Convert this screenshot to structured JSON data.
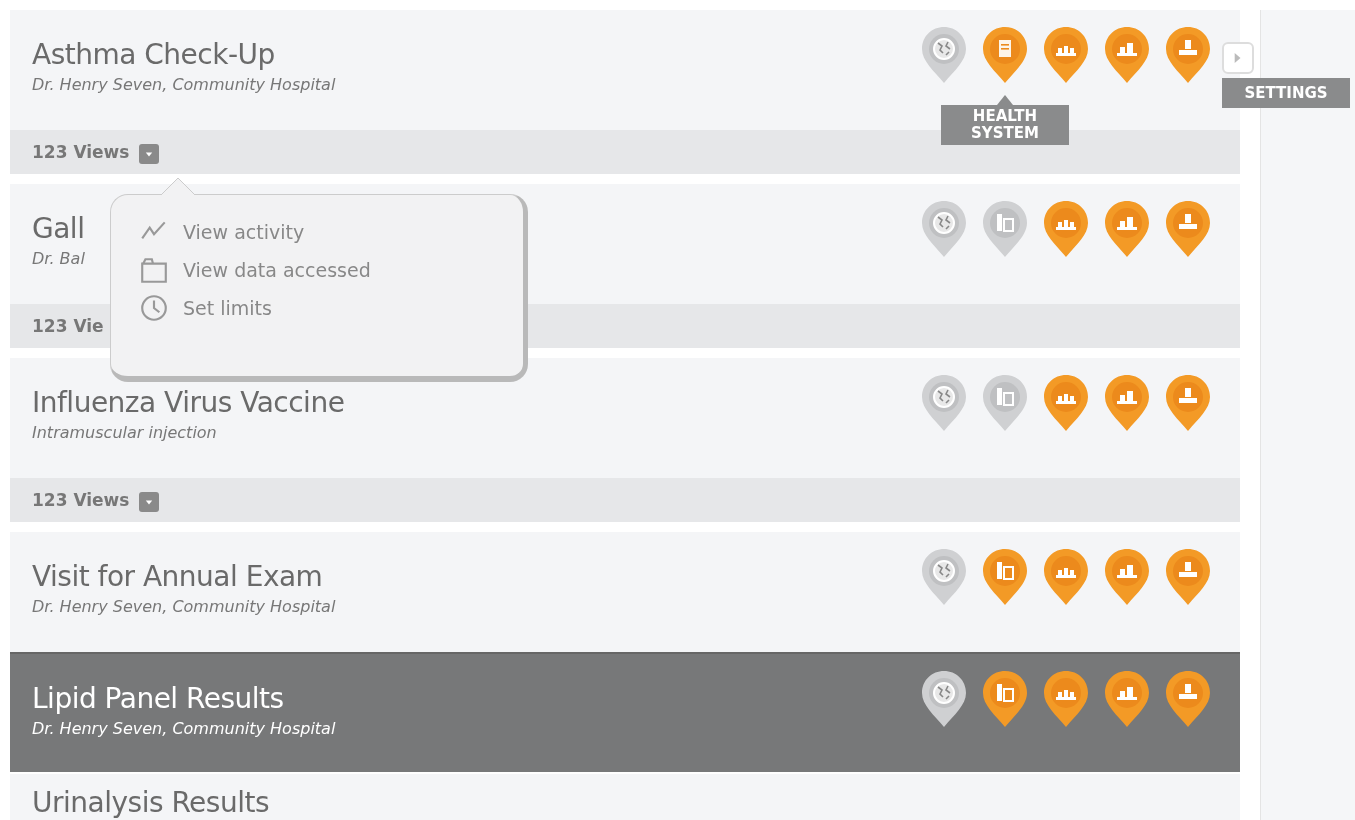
{
  "items": [
    {
      "title": "Asthma Check-Up",
      "subtitle": "Dr. Henry Seven, Community Hospital",
      "selected": false,
      "pins": [
        {
          "kind": "globe",
          "active": false
        },
        {
          "kind": "document",
          "active": true,
          "tooltip": "HEALTH SYSTEM"
        },
        {
          "kind": "group",
          "active": true
        },
        {
          "kind": "team",
          "active": true
        },
        {
          "kind": "person",
          "active": true
        }
      ],
      "settings": {
        "tooltip": "SETTINGS"
      },
      "views": {
        "label": "123 Views",
        "menu_button": true,
        "menu": [
          {
            "kind": "activity",
            "label": "View activity"
          },
          {
            "kind": "folder",
            "label": "View data accessed"
          },
          {
            "kind": "clock",
            "label": "Set limits"
          }
        ]
      }
    },
    {
      "title": "Gall",
      "subtitle": "Dr. Bal",
      "selected": false,
      "pins": [
        {
          "kind": "globe",
          "active": false
        },
        {
          "kind": "building",
          "active": false
        },
        {
          "kind": "group",
          "active": true
        },
        {
          "kind": "team",
          "active": true
        },
        {
          "kind": "person",
          "active": true
        }
      ],
      "views": {
        "label": "123 Vie"
      }
    },
    {
      "title": "Influenza Virus Vaccine",
      "subtitle": "Intramuscular injection",
      "selected": false,
      "pins": [
        {
          "kind": "globe",
          "active": false
        },
        {
          "kind": "building",
          "active": false
        },
        {
          "kind": "group",
          "active": true
        },
        {
          "kind": "team",
          "active": true
        },
        {
          "kind": "person",
          "active": true
        }
      ],
      "views": {
        "label": "123 Views",
        "menu_button": true
      }
    },
    {
      "title": "Visit for Annual Exam",
      "subtitle": "Dr. Henry Seven, Community Hospital",
      "selected": false,
      "pins": [
        {
          "kind": "globe",
          "active": false
        },
        {
          "kind": "building",
          "active": true
        },
        {
          "kind": "group",
          "active": true
        },
        {
          "kind": "team",
          "active": true
        },
        {
          "kind": "person",
          "active": true
        }
      ]
    },
    {
      "title": "Lipid Panel Results",
      "subtitle": "Dr. Henry Seven, Community Hospital",
      "selected": true,
      "pins": [
        {
          "kind": "globe",
          "active": false
        },
        {
          "kind": "building",
          "active": true
        },
        {
          "kind": "group",
          "active": true
        },
        {
          "kind": "team",
          "active": true
        },
        {
          "kind": "person",
          "active": true
        }
      ]
    },
    {
      "title": "Urinalysis Results",
      "selected": false
    }
  ]
}
